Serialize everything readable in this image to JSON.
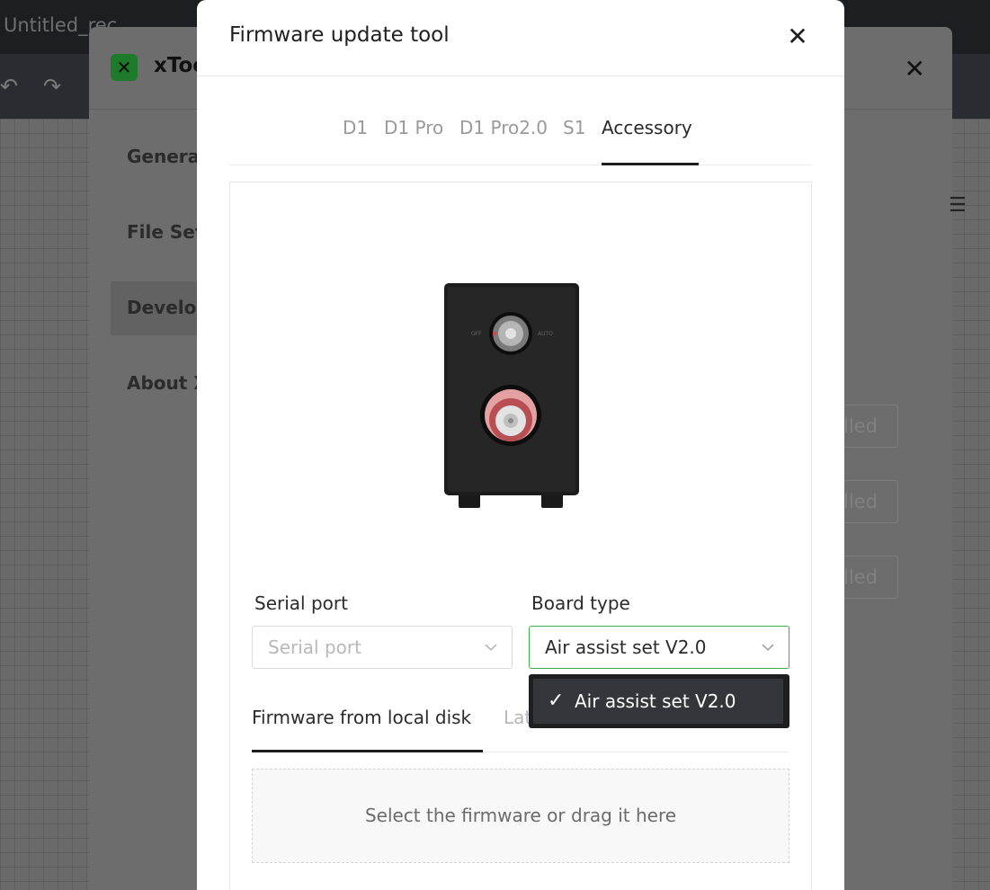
{
  "app": {
    "title": "Untitled_rec"
  },
  "settings": {
    "name": "xToo",
    "sidebar": [
      "Genera",
      "File Sett",
      "Develop",
      "About X"
    ],
    "ghost_buttons": [
      "lled",
      "lled",
      "lled"
    ]
  },
  "modal": {
    "title": "Firmware update tool",
    "tabs": [
      "D1",
      "D1 Pro",
      "D1 Pro2.0",
      "S1",
      "Accessory"
    ],
    "active_tab": "Accessory",
    "serial_port": {
      "label": "Serial port",
      "placeholder": "Serial port"
    },
    "board_type": {
      "label": "Board type",
      "value": "Air assist set V2.0",
      "options": [
        {
          "label": "Air assist set V2.0",
          "selected": true
        }
      ]
    },
    "subtabs": {
      "local": "Firmware from local disk",
      "latest": "Lat"
    },
    "dropzone_text": "Select the firmware or drag it here"
  },
  "colors": {
    "accent_border": "#3fae49",
    "dropdown_bg": "#1f1f23",
    "dropdown_item_bg": "#35363b"
  }
}
